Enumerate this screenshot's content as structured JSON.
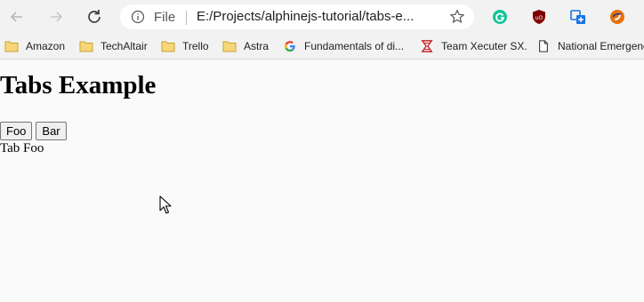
{
  "browser": {
    "omnibox": {
      "scheme_label": "File",
      "url": "E:/Projects/alphinejs-tutorial/tabs-e..."
    },
    "extensions": [
      {
        "icon": "grammarly-icon",
        "color": "#15c39a"
      },
      {
        "icon": "ublock-icon",
        "color": "#800000"
      },
      {
        "icon": "translate-icon",
        "color": "#1a73e8"
      },
      {
        "icon": "extension-icon",
        "color": "#e8710a"
      }
    ]
  },
  "bookmarks": [
    {
      "label": "Amazon",
      "icon": "folder-icon"
    },
    {
      "label": "TechAltair",
      "icon": "folder-icon"
    },
    {
      "label": "Trello",
      "icon": "folder-icon"
    },
    {
      "label": "Astra",
      "icon": "folder-icon"
    },
    {
      "label": "Fundamentals of di...",
      "icon": "google-icon"
    },
    {
      "label": "Team Xecuter SX.",
      "icon": "xecuter-icon"
    },
    {
      "label": "National Emergenc",
      "icon": "page-icon"
    }
  ],
  "page": {
    "title": "Tabs Example",
    "tabs": [
      {
        "label": "Foo"
      },
      {
        "label": "Bar"
      }
    ],
    "active_content": "Tab Foo"
  }
}
